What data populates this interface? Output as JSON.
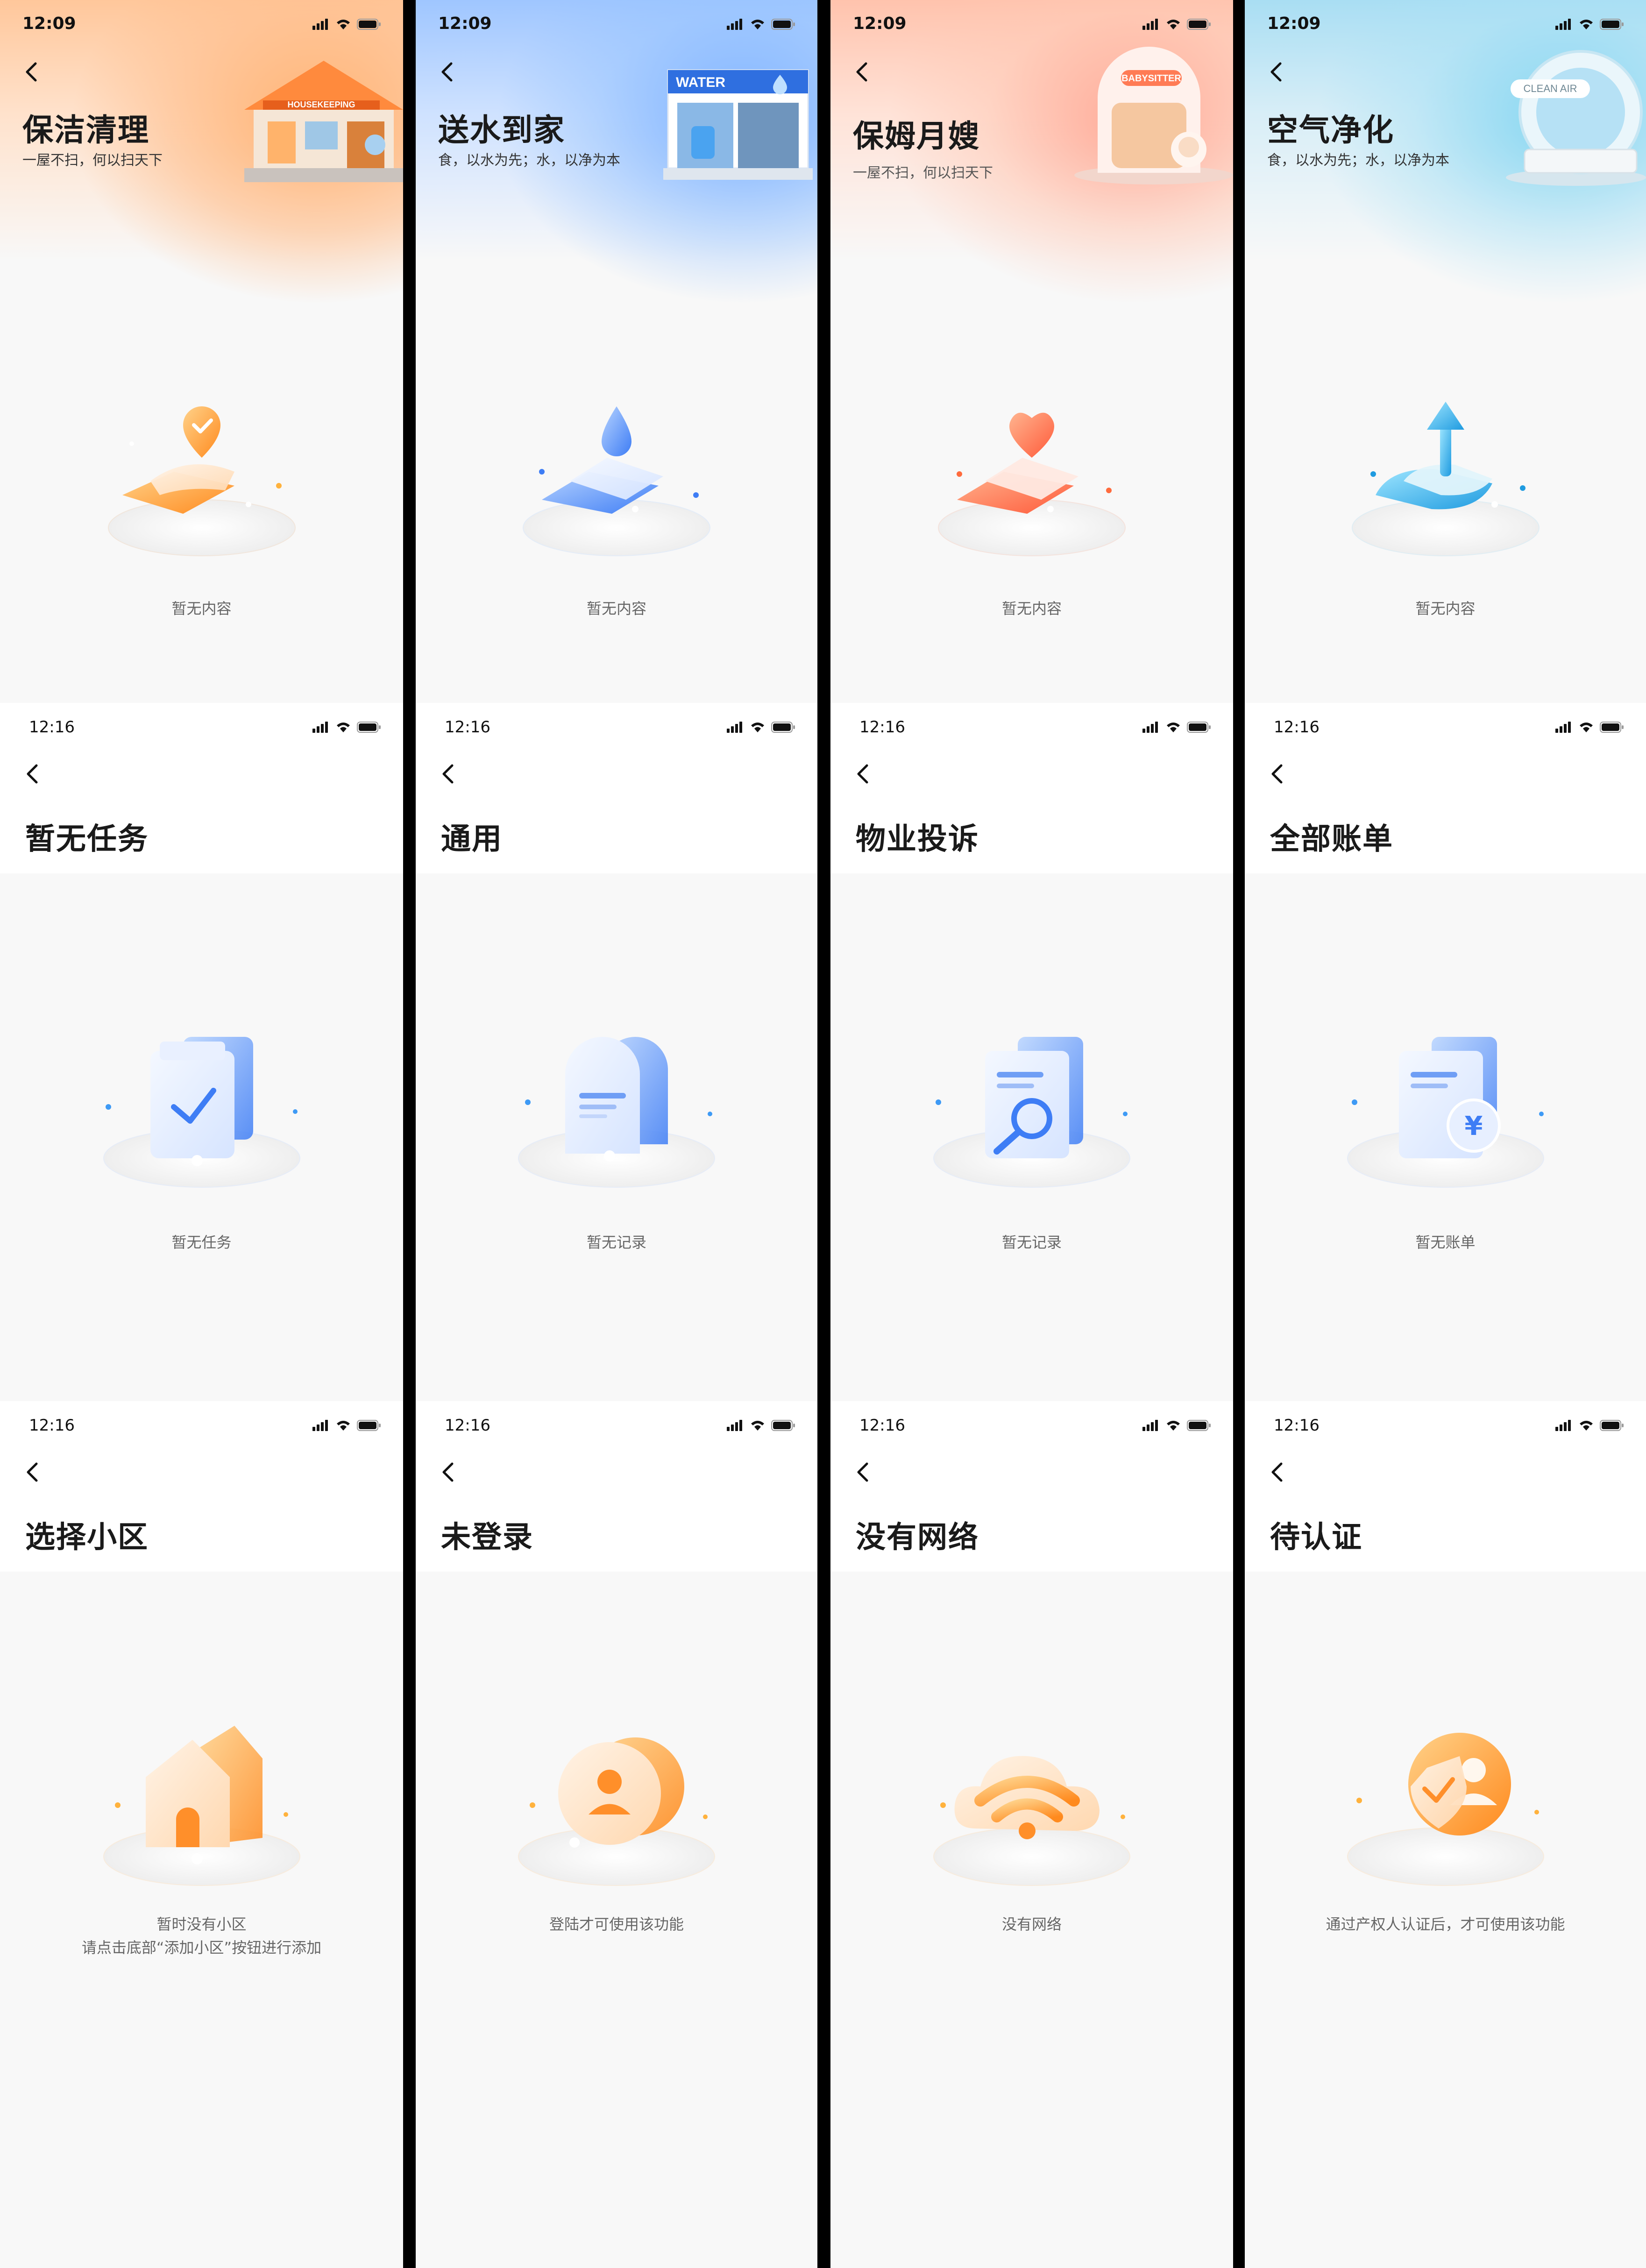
{
  "status_time_top": "12:09",
  "status_time": "12:16",
  "services": [
    {
      "title": "保洁清理",
      "subtitle": "一屋不扫，何以扫天下",
      "sign": "HOUSEKEEPING",
      "empty": "暂无内容"
    },
    {
      "title": "送水到家",
      "subtitle": "食，以水为先；水，以净为本",
      "sign": "WATER",
      "empty": "暂无内容"
    },
    {
      "title": "保姆月嫂",
      "subtitle": "一屋不扫，何以扫天下",
      "sign": "BABYSITTER",
      "empty": "暂无内容"
    },
    {
      "title": "空气净化",
      "subtitle": "食，以水为先；水，以净为本",
      "sign": "CLEAN AIR",
      "empty": "暂无内容"
    }
  ],
  "pages_row2": [
    {
      "title": "暂无任务",
      "empty": "暂无任务"
    },
    {
      "title": "通用",
      "empty": "暂无记录"
    },
    {
      "title": "物业投诉",
      "empty": "暂无记录"
    },
    {
      "title": "全部账单",
      "empty": "暂无账单",
      "currency_symbol": "¥"
    }
  ],
  "pages_row3": [
    {
      "title": "选择小区",
      "empty_line1": "暂时没有小区",
      "empty_line2": "请点击底部“添加小区”按钮进行添加"
    },
    {
      "title": "未登录",
      "empty_line1": "登陆才可使用该功能"
    },
    {
      "title": "没有网络",
      "empty_line1": "没有网络"
    },
    {
      "title": "待认证",
      "empty_line1": "通过产权人认证后，才可使用该功能"
    }
  ]
}
